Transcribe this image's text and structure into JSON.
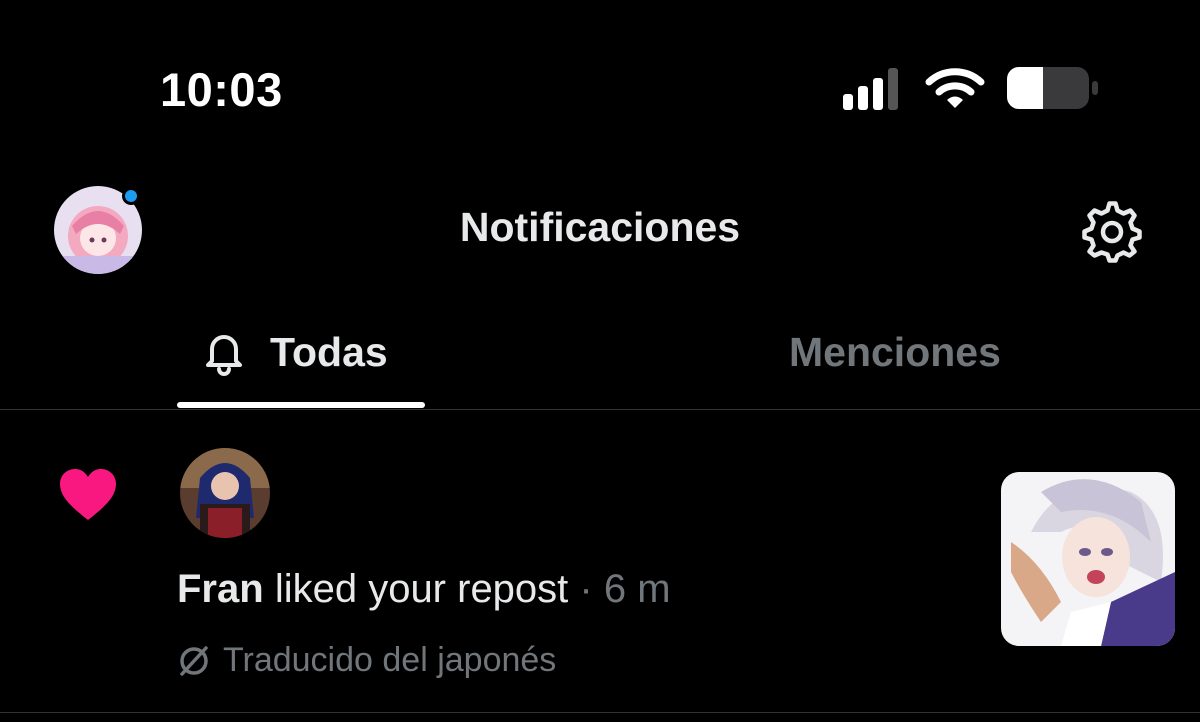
{
  "status_bar": {
    "time": "10:03",
    "icons": [
      "signal-icon",
      "wifi-icon",
      "battery-icon"
    ],
    "battery_level": 0.45
  },
  "header": {
    "title": "Notificaciones",
    "has_presence_dot": true,
    "settings_icon": "gear-icon"
  },
  "tabs": [
    {
      "label": "Todas",
      "icon": "bell-icon",
      "selected": true
    },
    {
      "label": "Menciones",
      "selected": false
    }
  ],
  "notification": {
    "type_icon": "heart-icon",
    "actor": "Fran",
    "action": "liked your repost",
    "separator": "·",
    "time": "6 m",
    "translation_note": "Traducido del japonés"
  },
  "colors": {
    "background": "#000000",
    "text_primary": "#e7e9ea",
    "text_secondary": "#71767b",
    "accent_blue": "#1d9bf0",
    "like_pink": "#f91880",
    "divider": "#2f3336"
  }
}
